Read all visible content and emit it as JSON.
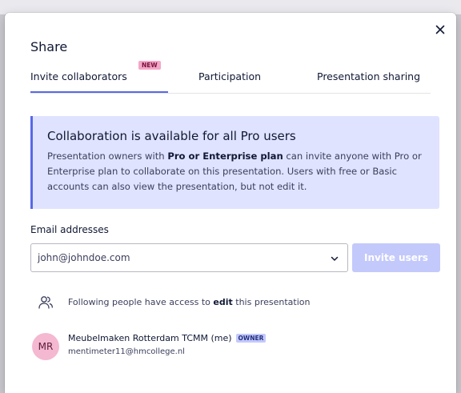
{
  "dialog": {
    "title": "Share",
    "close_icon": "close-icon"
  },
  "tabs": [
    {
      "label": "Invite collaborators",
      "active": true,
      "badge": "NEW"
    },
    {
      "label": "Participation",
      "active": false
    },
    {
      "label": "Presentation sharing",
      "active": false
    }
  ],
  "callout": {
    "title": "Collaboration is available for all Pro users",
    "body_part1": "Presentation owners with ",
    "body_bold": "Pro or Enterprise plan",
    "body_part2": " can invite anyone with Pro or Enterprise plan to collaborate on this presentation. Users with free or Basic accounts can also view the presentation, but not edit it."
  },
  "invite_form": {
    "label": "Email addresses",
    "email_value": "john@johndoe.com",
    "button_label": "Invite users",
    "chevron_icon": "chevron-down-icon"
  },
  "access": {
    "icon": "people-icon",
    "text_before": "Following people have access to ",
    "text_emphasis": "edit",
    "text_after": " this presentation"
  },
  "members": [
    {
      "initials": "MR",
      "name": "Meubelmaken Rotterdam TCMM (me)",
      "role_badge": "OWNER",
      "email": "mentimeter11@hmcollege.nl"
    }
  ],
  "colors": {
    "accent": "#5769e7",
    "callout_bg": "#dfe3ff",
    "button_disabled": "#c3c9fb",
    "new_badge": "#f3a7c8",
    "avatar": "#f4b8d1"
  }
}
